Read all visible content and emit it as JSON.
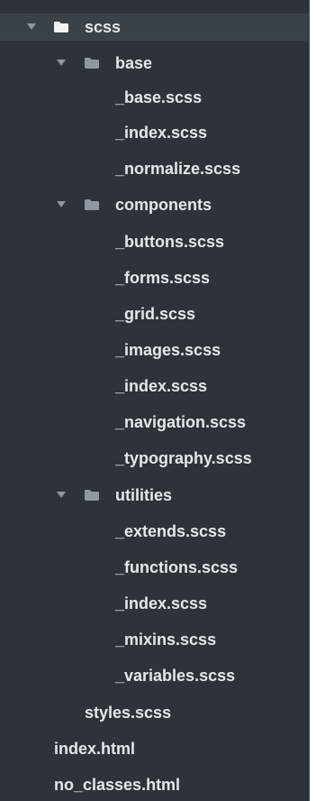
{
  "tree": {
    "root": {
      "label": "scss",
      "children": {
        "base": {
          "label": "base",
          "files": [
            "_base.scss",
            "_index.scss",
            "_normalize.scss"
          ]
        },
        "components": {
          "label": "components",
          "files": [
            "_buttons.scss",
            "_forms.scss",
            "_grid.scss",
            "_images.scss",
            "_index.scss",
            "_navigation.scss",
            "_typography.scss"
          ]
        },
        "utilities": {
          "label": "utilities",
          "files": [
            "_extends.scss",
            "_functions.scss",
            "_index.scss",
            "_mixins.scss",
            "_variables.scss"
          ]
        },
        "styles": "styles.scss"
      }
    },
    "top_files": [
      "index.html",
      "no_classes.html"
    ]
  },
  "colors": {
    "panel_bg": "#2d3339",
    "selected_bg": "#3a4147",
    "text": "#e4e8ec",
    "icon": "#8f98a1",
    "root_folder_icon": "#f1f3f5"
  },
  "icons": {
    "expanded": "chevron-down-icon",
    "folder": "folder-icon"
  }
}
